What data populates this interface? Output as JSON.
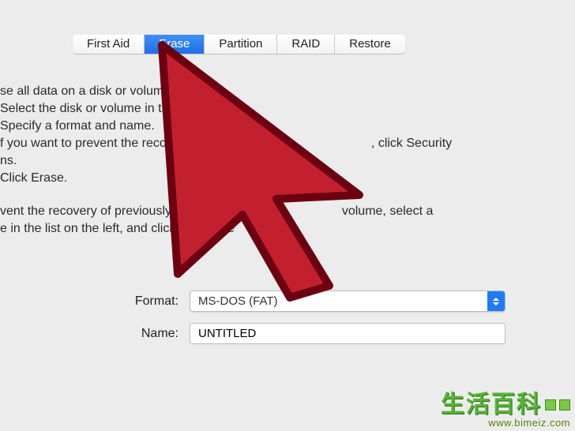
{
  "tabs": {
    "first_aid": "First Aid",
    "erase": "Erase",
    "partition": "Partition",
    "raid": "RAID",
    "restore": "Restore"
  },
  "body": {
    "l1": "se all data on a disk or volume:",
    "l2": "Select the disk or volume in the li",
    "l3": "Specify a format and name.",
    "l4a": "f you want to prevent the recovery",
    "l4b": ", click Security",
    "l5": "ns.",
    "l6": "Click Erase.",
    "l7a": "vent the recovery of previously deleted",
    "l7b": "volume, select a",
    "l8a": "e in the list on the left, and click Erase Fre",
    "l8b": "ce."
  },
  "form": {
    "format_label": "Format:",
    "format_value": "MS-DOS (FAT)",
    "name_label": "Name:",
    "name_value": "UNTITLED"
  },
  "watermark": {
    "title": "生活百科",
    "url": "www.bimeiz.com"
  }
}
